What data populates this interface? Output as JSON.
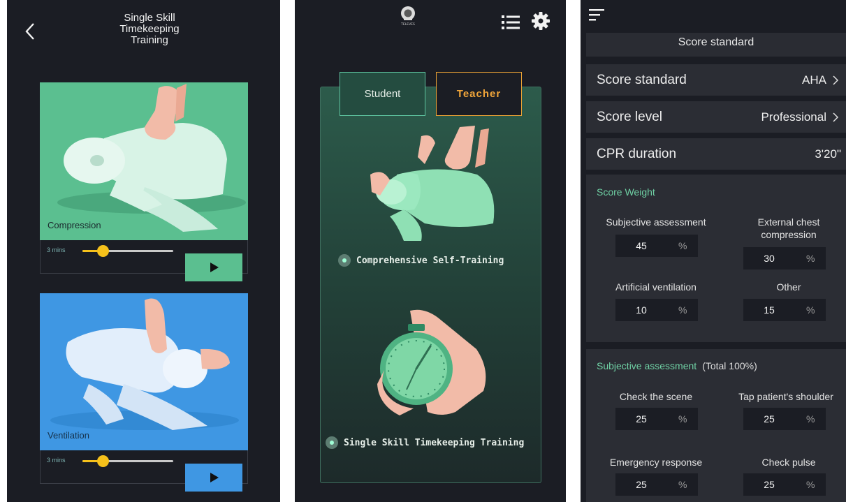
{
  "screen1": {
    "title_lines": [
      "Single Skill",
      "Timekeeping",
      "Training"
    ],
    "cards": [
      {
        "label": "Compression",
        "duration_label": "3 mins",
        "slider_fraction": 0.22,
        "color": "#5bbf90"
      },
      {
        "label": "Ventilation",
        "duration_label": "3 mins",
        "slider_fraction": 0.22,
        "color": "#3f97e3"
      }
    ]
  },
  "screen2": {
    "logo_text": "TELEVES",
    "tabs": [
      {
        "label": "Student",
        "selected": false
      },
      {
        "label": "Teacher",
        "selected": true
      }
    ],
    "modes": [
      {
        "label": "Comprehensive Self-Training"
      },
      {
        "label": "Single Skill Timekeeping Training"
      }
    ],
    "accent_color": "#e9a134"
  },
  "screen3": {
    "header": "Score standard",
    "rows": [
      {
        "label": "Score standard",
        "value": "AHA"
      },
      {
        "label": "Score level",
        "value": "Professional"
      },
      {
        "label": "CPR duration",
        "value": "3'20\""
      }
    ],
    "score_weight": {
      "title": "Score Weight",
      "items": [
        {
          "label": "Subjective assessment",
          "value": "45",
          "unit": "%"
        },
        {
          "label": "External chest compression",
          "value": "30",
          "unit": "%"
        },
        {
          "label": "Artificial ventilation",
          "value": "10",
          "unit": "%"
        },
        {
          "label": "Other",
          "value": "15",
          "unit": "%"
        }
      ]
    },
    "subjective": {
      "title": "Subjective assessment",
      "total": "(Total 100%)",
      "items": [
        {
          "label": "Check the scene",
          "value": "25",
          "unit": "%"
        },
        {
          "label": "Tap patient's shoulder",
          "value": "25",
          "unit": "%"
        },
        {
          "label": "Emergency response",
          "value": "25",
          "unit": "%"
        },
        {
          "label": "Check pulse",
          "value": "25",
          "unit": "%"
        }
      ]
    },
    "section_color": "#6fd0a4"
  }
}
